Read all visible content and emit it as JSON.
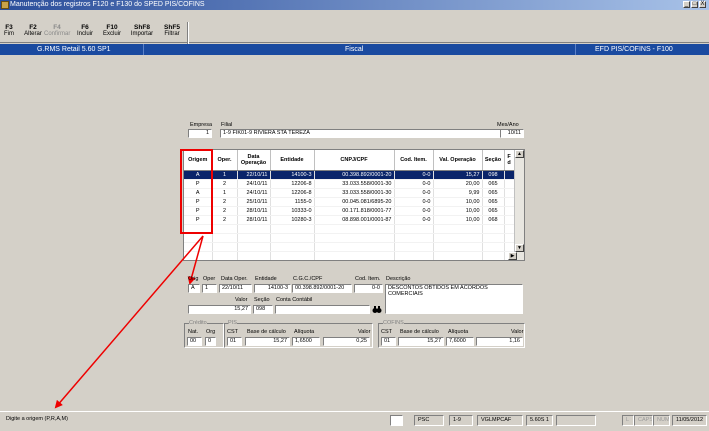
{
  "window": {
    "title": "Manutenção dos registros F120 e F130 do SPED PIS/COFINS",
    "buttons": [
      "_",
      "□",
      "X"
    ]
  },
  "toolbar": [
    {
      "key": "F3",
      "label": "Fim",
      "enabled": true
    },
    {
      "key": "F2",
      "label": "Alterar",
      "enabled": true
    },
    {
      "key": "F4",
      "label": "Confirmar",
      "enabled": false
    },
    {
      "key": "F6",
      "label": "Incluir",
      "enabled": true
    },
    {
      "key": "F10",
      "label": "Excluir",
      "enabled": true
    },
    {
      "key": "ShF8",
      "label": "Importar",
      "enabled": true
    },
    {
      "key": "ShF5",
      "label": "Filtrar",
      "enabled": true
    }
  ],
  "header": {
    "left": "G.RMS Retail 5.60 SP1",
    "center": "Fiscal",
    "right": "EFD PIS/COFINS - F100"
  },
  "top_fields": {
    "empresa_label": "Empresa",
    "empresa_value": "1",
    "filial_label": "Filial",
    "filial_value": "1-9 FIK01-9 RIVIERA STA TEREZA",
    "mesano_label": "Mes/Ano",
    "mesano_value": "10/11"
  },
  "grid": {
    "columns": [
      "Origem",
      "Oper.",
      "Data\nOperação",
      "Entidade",
      "CNPJ/CPF",
      "Cod. Item.",
      "Val. Operação",
      "Seção",
      "F\nd"
    ],
    "rows": [
      [
        "A",
        "1",
        "22/10/11",
        "14100-3",
        "00.398.892/0001-20",
        "0-0",
        "15,27",
        "098",
        ""
      ],
      [
        "P",
        "2",
        "24/10/11",
        "12206-8",
        "33.033.558/0001-30",
        "0-0",
        "20,00",
        "065",
        ""
      ],
      [
        "A",
        "1",
        "24/10/11",
        "12206-8",
        "33.033.558/0001-30",
        "0-0",
        "9,99",
        "065",
        ""
      ],
      [
        "P",
        "2",
        "25/10/11",
        "1155-0",
        "00.045.081/6895-20",
        "0-0",
        "10,00",
        "065",
        ""
      ],
      [
        "P",
        "2",
        "28/10/11",
        "10333-0",
        "00.171.818/0001-77",
        "0-0",
        "10,00",
        "065",
        ""
      ],
      [
        "P",
        "2",
        "28/10/11",
        "10280-3",
        "08.898.001/0001-87",
        "0-0",
        "10,00",
        "068",
        ""
      ]
    ],
    "selected_row": 0,
    "scroll_up": "▲",
    "scroll_down": "▼",
    "scroll_right": "▶"
  },
  "detail": {
    "labels": {
      "orig": "Orig",
      "oper": "Oper",
      "data": "Data Oper.",
      "entidade": "Entidade",
      "cgc": "C.G.C./CPF",
      "cod": "Cod. Item.",
      "descricao": "Descrição",
      "valor": "Valor",
      "secao": "Seção",
      "conta": "Conta Contábil"
    },
    "orig": "A",
    "oper": "1",
    "data": "22/10/11",
    "entidade": "14100-3",
    "cgc": "00.398.892/0001-20",
    "cod": "0-0",
    "descricao": "DESCONTOS OBTIDOS EM ACORDOS COMERCIAIS",
    "valor": "15,27",
    "secao": "098",
    "conta": ""
  },
  "credito": {
    "title": "Crédito",
    "nat_label": "Nat.",
    "nat": "00",
    "org_label": "Org",
    "org": "0"
  },
  "pis": {
    "title": "PIS",
    "cst_label": "CST",
    "cst": "01",
    "base_label": "Base de cálculo",
    "base": "15,27",
    "aliq_label": "Alíquota",
    "aliq": "1,6500",
    "valor_label": "Valor",
    "valor": "0,25"
  },
  "cofins": {
    "title": "COFINS",
    "cst_label": "CST",
    "cst": "01",
    "base_label": "Base de cálculo",
    "base": "15,27",
    "aliq_label": "Alíquota",
    "aliq": "7,6000",
    "valor_label": "Valor",
    "valor": "1,16"
  },
  "status": {
    "message": "Digite a origem (P,R,A,M)",
    "p1": "PSC",
    "p2": "1-9",
    "p3": "VGLMPCAF",
    "p4": "5.60S 1",
    "p5": "",
    "l": "L",
    "caps": "CAPS",
    "num": "NUM",
    "date": "11/05/2012"
  },
  "colors": {
    "accent": "#1a4aa0",
    "annotation": "#e00000",
    "selection": "#0a246a"
  }
}
